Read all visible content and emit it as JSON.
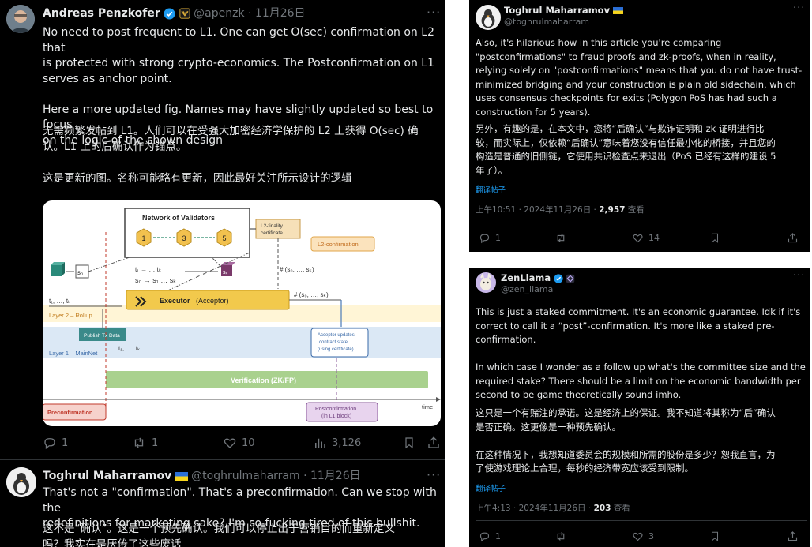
{
  "left_panel": {
    "tweet1": {
      "author_name": "Andreas Penzkofer",
      "handle_time": "@apenzk · 11月26日",
      "more": "···",
      "text_en": "No need to post frequent to L1. One can get  O(sec) confirmation on L2 that\nis protected with strong crypto-economics. The Postconfirmation on L1\nserves as anchor point.\n\nHere a more updated fig. Names may have slightly updated so best to focus\non the logic of the shown design",
      "text_zh": "无需频繁发帖到 L1。人们可以在受强大加密经济学保护的 L2 上获得 O(sec) 确\n认。L1 上的后确认作为锚点。\n\n这是更新的图。名称可能略有更新，因此最好关注所示设计的逻辑",
      "figure": {
        "network_title": "Network of Validators",
        "validators": [
          "1",
          "3",
          "5"
        ],
        "l2_finality": "L2-finality\ncertificate",
        "l2_confirmation": "L2-confirmation",
        "state_seq": "s₀ → s₁ … sₖ",
        "tx_seq_top": "t₁ → … tₖ",
        "state0": "s₀",
        "statek": "sₖ",
        "hash_top": "# (s₀, …, sₖ)",
        "hash_mid": "# (s₀, …, sₖ)",
        "tx_left": "t₁, …, tₖ",
        "executor": "Executor",
        "acceptor": "(Acceptor)",
        "layer2": "Layer 2 – Rollup",
        "publish": "Publish Tx Data",
        "tx_mid": "t₁, …, tₖ",
        "acceptor_updates": "Acceptor updates\ncontract state\n(using certificate)",
        "layer1": "Layer 1 – MainNet",
        "verification": "Verification (ZK/FP)",
        "preconfirmation": "Preconfirmation",
        "postconfirmation": "Postconfirmation\n(in L1 block)",
        "time": "time"
      },
      "actions": {
        "replies": "1",
        "reposts": "1",
        "likes": "10",
        "views": "3,126"
      }
    },
    "tweet2": {
      "author_name": "Toghrul Maharramov",
      "handle_time": "@toghrulmaharram · 11月26日",
      "more": "···",
      "text_en": "That's not a \"confirmation\". That's a preconfirmation. Can we stop with the\nredefinitions for marketing sake? I'm so fucking tired of this bullshit.",
      "text_zh": "这不是“确认”。这是一个预先确认。我们可以停止出于营销目的而重新定义\n吗？我实在是厌倦了这些废话"
    }
  },
  "top_right": {
    "author_name": "Toghrul Maharramov",
    "handle": "@toghrulmaharram",
    "more": "···",
    "text_en": "Also, it's hilarious how in this article you're comparing\n\"postconfirmations\" to fraud proofs and zk-proofs, when in reality,\nrelying solely on \"postconfirmations\" means that you do not have trust-\nminimized bridging and your construction is plain old sidechain, which\nuses consensus checkpoints for exits (Polygon PoS has had such a\nconstruction for 5 years).",
    "text_zh": "另外，有趣的是，在本文中，您将“后确认”与欺诈证明和 zk 证明进行比\n较，而实际上，仅依赖“后确认”意味着您没有信任最小化的桥接，并且您的\n构造是普通的旧侧链，它使用共识检查点来退出（PoS 已经有这样的建设 5\n年了）。",
    "translate": "翻译帖子",
    "timestamp": "上午10:51 · 2024年11月26日 · ",
    "views_count": "2,957",
    "views_label": " 查看",
    "actions": {
      "replies": "1",
      "reposts": "",
      "likes": "14"
    }
  },
  "bottom_right": {
    "author_name": "ZenLlama",
    "handle": "@zen_llama",
    "more": "···",
    "text_en": "This is just a staked commitment. It's an economic guarantee. Idk if it's\ncorrect to call it a “post”-confirmation. It's more like a staked pre-\nconfirmation.\n\nIn which case I wonder as a follow up what's the committee size and the\nrequired stake? There should be a limit on the economic bandwidth per\nsecond to be game theoretically sound imho.",
    "text_zh": "这只是一个有赌注的承诺。这是经济上的保证。我不知道将其称为“后”确认\n是否正确。这更像是一种预先确认。\n\n在这种情况下，我想知道委员会的规模和所需的股份是多少？恕我直言，为\n了使游戏理论上合理，每秒的经济带宽应该受到限制。",
    "translate": "翻译帖子",
    "timestamp": "上午4:13 · 2024年11月26日 · ",
    "views_count": "203",
    "views_label": " 查看",
    "actions": {
      "replies": "1",
      "reposts": "",
      "likes": "3"
    }
  },
  "colors": {
    "background": "#000000",
    "text": "#e7e9ea",
    "muted": "#71767b",
    "link": "#1d9bf0",
    "verified": "#1d9bf0",
    "validator_hex": "#f2c14e",
    "executor": "#f2c94c",
    "verification": "#a9d18e"
  }
}
